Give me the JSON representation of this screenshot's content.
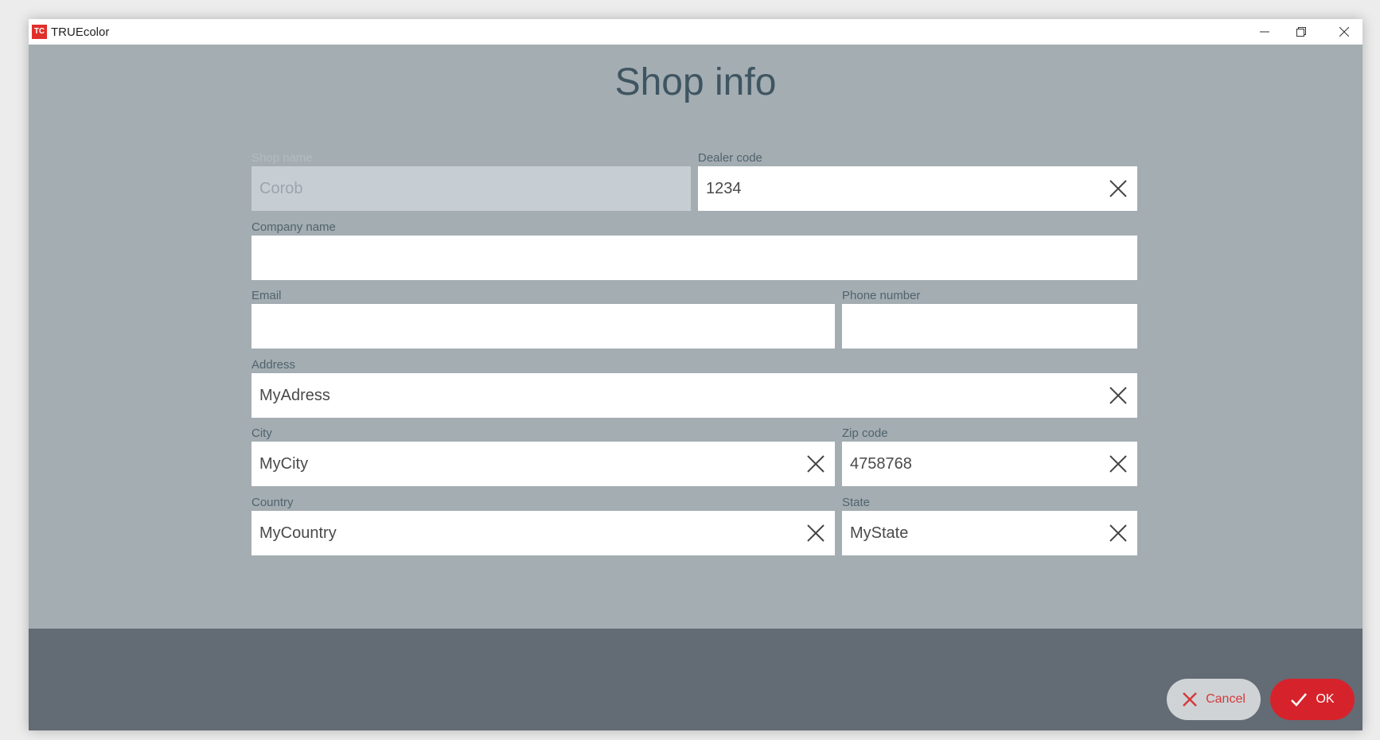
{
  "window": {
    "title": "TRUEcolor",
    "logo_text": "TC",
    "accent_color": "#d6232b",
    "controls": [
      "minimize-icon",
      "restore-icon",
      "close-icon"
    ]
  },
  "page": {
    "title": "Shop info"
  },
  "fields": {
    "shop_name": {
      "label": "Shop name",
      "value": "Corob",
      "disabled": true
    },
    "dealer_code": {
      "label": "Dealer code",
      "value": "1234"
    },
    "company_name": {
      "label": "Company name",
      "value": ""
    },
    "email": {
      "label": "Email",
      "value": ""
    },
    "phone_number": {
      "label": "Phone number",
      "value": ""
    },
    "address": {
      "label": "Address",
      "value": "MyAdress"
    },
    "city": {
      "label": "City",
      "value": "MyCity"
    },
    "zip_code": {
      "label": "Zip code",
      "value": "4758768"
    },
    "country": {
      "label": "Country",
      "value": "MyCountry"
    },
    "state": {
      "label": "State",
      "value": "MyState"
    }
  },
  "buttons": {
    "cancel_label": "Cancel",
    "ok_label": "OK"
  }
}
